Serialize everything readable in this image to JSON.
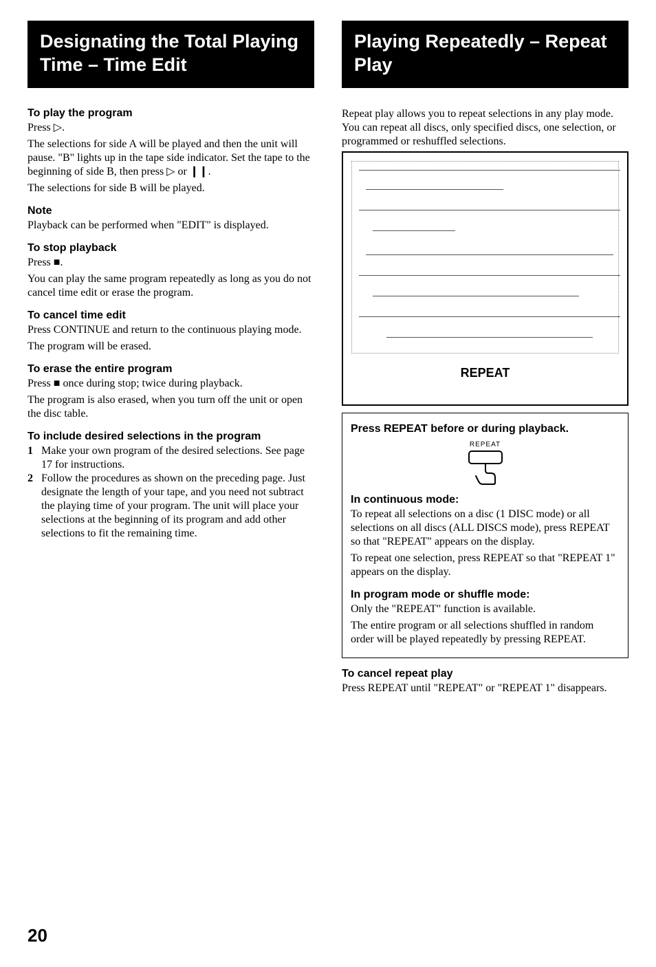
{
  "left": {
    "banner": "Designating the Total Playing Time – Time Edit",
    "s1_h": "To play the program",
    "s1_p1": "Press ▷.",
    "s1_p2": "The selections for side A will be played and then the unit will pause. \"B\" lights up in the tape side indicator. Set the tape to the beginning of side B, then press ▷ or ❙❙.",
    "s1_p3": "The selections for side B will be played.",
    "s2_h": "Note",
    "s2_p1": "Playback can be performed when \"EDIT\" is displayed.",
    "s3_h": "To stop playback",
    "s3_p1": "Press ■.",
    "s3_p2": "You can play the same program repeatedly as long as you do not cancel time edit or erase the program.",
    "s4_h": "To cancel time edit",
    "s4_p1": "Press CONTINUE and return to the continuous playing mode.",
    "s4_p2": "The program will be erased.",
    "s5_h": "To erase the entire program",
    "s5_p1": "Press ■ once during stop; twice during playback.",
    "s5_p2": "The program is also erased, when you turn off the unit or open the disc table.",
    "s6_h": "To include desired selections in the program",
    "s6_1": "Make your own program of the desired selections. See page 17 for instructions.",
    "s6_2": "Follow the procedures as shown on the preceding page. Just designate the length of your tape, and you need not subtract the playing time of your program. The unit will place your selections at the beginning of its program and add other selections to fit the remaining time."
  },
  "right": {
    "banner": "Playing Repeatedly – Repeat Play",
    "intro": "Repeat play allows you to repeat selections in any play mode. You can repeat all discs, only specified discs, one selection, or programmed or reshuffled selections.",
    "device_label": "REPEAT",
    "box_h": "Press REPEAT before or during playback.",
    "btn_caption": "REPEAT",
    "cont_h": "In continuous mode:",
    "cont_p1": "To repeat all selections on a disc (1 DISC mode) or all selections on all discs (ALL DISCS mode), press REPEAT so that \"REPEAT\" appears on the display.",
    "cont_p2": "To repeat one selection, press REPEAT so that \"REPEAT 1\" appears on the display.",
    "prog_h": "In program mode or shuffle mode:",
    "prog_p1": "Only the \"REPEAT\" function is available.",
    "prog_p2": "The entire program or all selections shuffled in random order will be played repeatedly by pressing REPEAT.",
    "cancel_h": "To cancel repeat play",
    "cancel_p": "Press REPEAT until \"REPEAT\" or \"REPEAT 1\" disappears."
  },
  "page_number": "20"
}
